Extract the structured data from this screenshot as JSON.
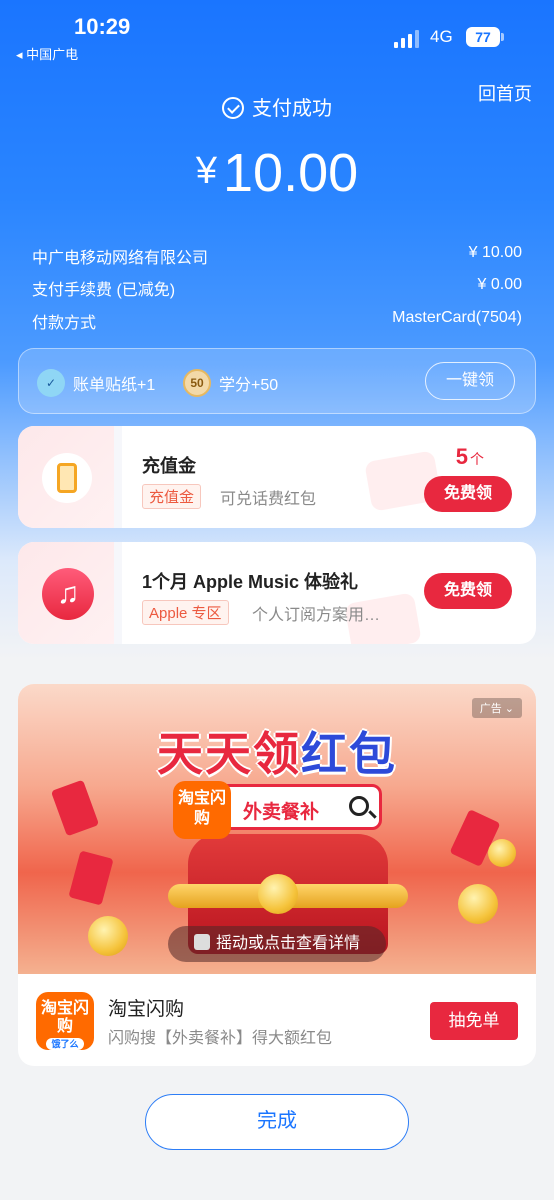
{
  "status_bar": {
    "time": "10:29",
    "carrier": "◂ 中国广电",
    "network": "4G",
    "battery": "77"
  },
  "header": {
    "home_label": "回首页",
    "status_title": "支付成功",
    "currency_symbol": "¥",
    "amount": "10.00"
  },
  "details": [
    {
      "label": "中广电移动网络有限公司",
      "value": "¥ 10.00"
    },
    {
      "label": "支付手续费 (已减免)",
      "value": "¥ 0.00"
    },
    {
      "label": "付款方式",
      "value": "MasterCard(7504)"
    }
  ],
  "bonus_bar": {
    "item1_label": "账单贴纸+1",
    "item2_badge": "50",
    "item2_label": "学分+50",
    "claim_all_label": "一键领"
  },
  "coupons": [
    {
      "title": "充值金",
      "tag": "充值金",
      "desc": "可兑话费红包",
      "count": "5",
      "count_unit": "个",
      "button": "免费领"
    },
    {
      "title": "1个月 Apple Music 体验礼",
      "tag": "Apple 专区",
      "desc": "个人订阅方案用…",
      "button": "免费领"
    }
  ],
  "ad": {
    "badge": "广告",
    "headline_red": "天天领",
    "headline_blue": "红包",
    "search_logo": "淘宝闪购",
    "search_text": "外卖餐补",
    "hint": "摇动或点击查看详情",
    "logo_text": "淘宝闪购",
    "logo_sub": "饿了么",
    "name": "淘宝闪购",
    "desc": "闪购搜【外卖餐补】得大额红包",
    "cta": "抽免单"
  },
  "done_label": "完成",
  "colors": {
    "primary_blue": "#1a75ff",
    "accent_red": "#e8283f"
  }
}
